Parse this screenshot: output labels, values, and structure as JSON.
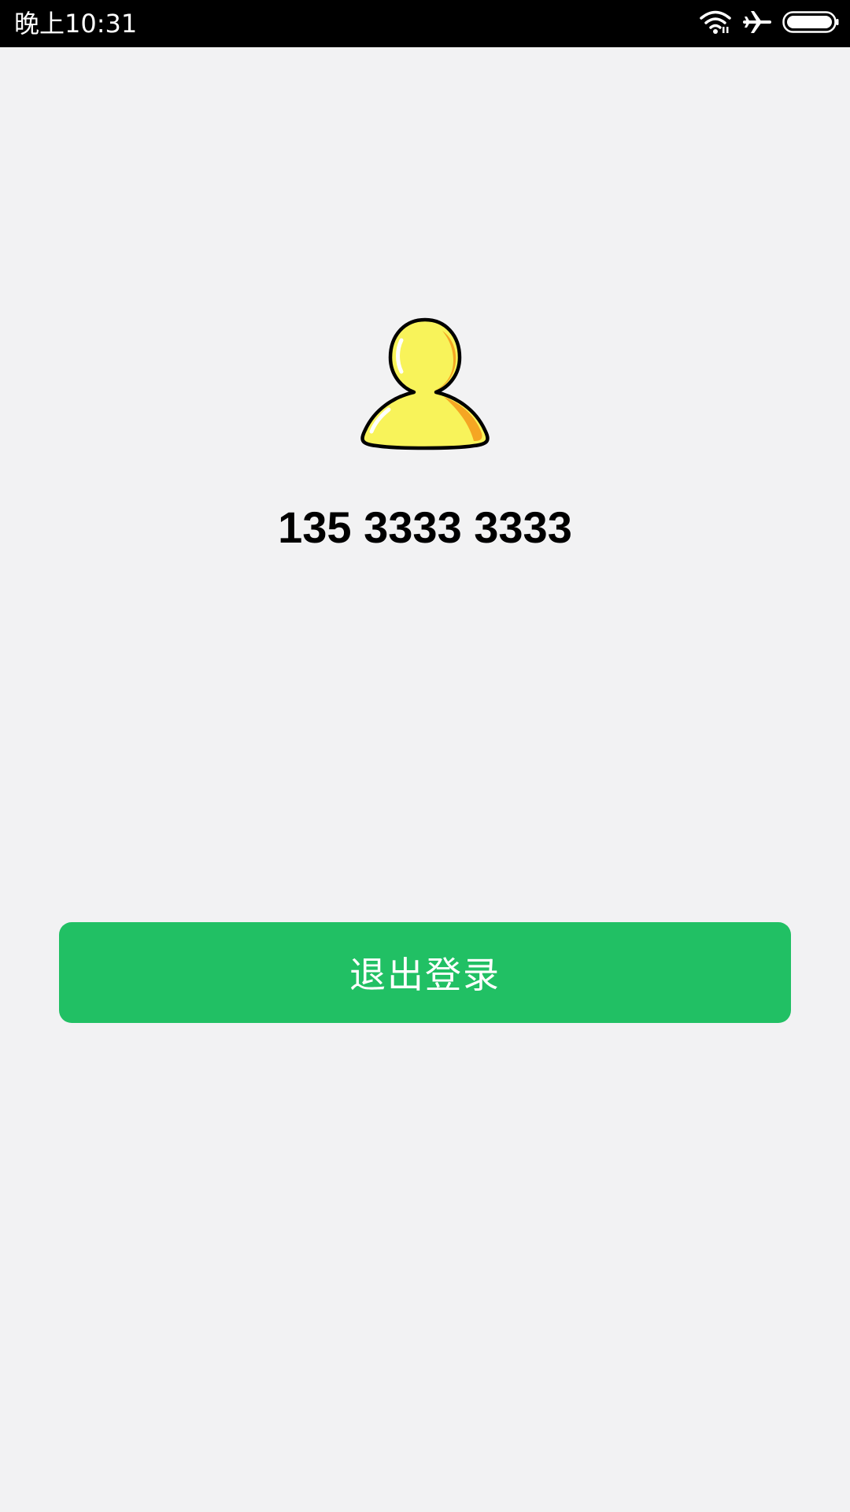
{
  "status_bar": {
    "time": "晚上10:31",
    "icons": [
      "wifi-icon",
      "airplane-icon",
      "battery-icon"
    ]
  },
  "profile": {
    "avatar_icon": "user-avatar-icon",
    "phone_number": "135 3333 3333"
  },
  "actions": {
    "logout_label": "退出登录"
  },
  "colors": {
    "background": "#f2f2f3",
    "status_bar": "#000000",
    "button": "#21c064",
    "button_text": "#ffffff",
    "avatar_fill": "#f8f35a",
    "avatar_shadow": "#f5a623"
  }
}
